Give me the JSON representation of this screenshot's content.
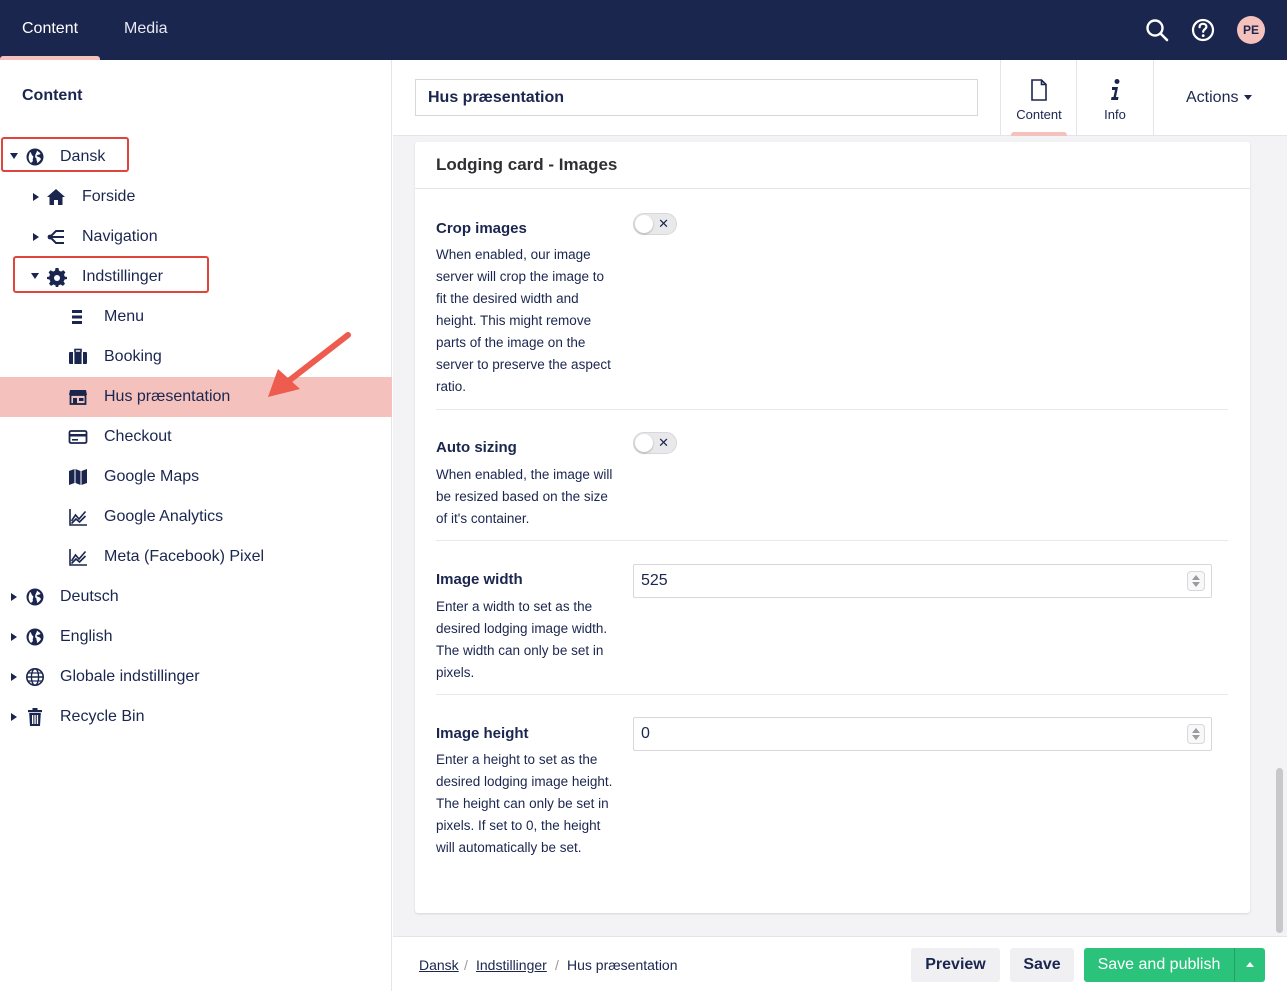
{
  "topnav": {
    "items": [
      {
        "label": "Content",
        "active": true
      },
      {
        "label": "Media",
        "active": false
      }
    ],
    "search_icon": "search-icon",
    "help_icon": "help-icon",
    "avatar_initials": "PE"
  },
  "sidebar": {
    "title": "Content",
    "items": [
      {
        "label": "Dansk",
        "icon": "globe-icon",
        "expanded": true
      },
      {
        "label": "Forside",
        "icon": "home-icon",
        "expanded": false
      },
      {
        "label": "Navigation",
        "icon": "navigation-icon",
        "expanded": false
      },
      {
        "label": "Indstillinger",
        "icon": "settings-icon",
        "expanded": true
      },
      {
        "label": "Menu",
        "icon": "menu-icon"
      },
      {
        "label": "Booking",
        "icon": "briefcase-icon"
      },
      {
        "label": "Hus præsentation",
        "icon": "store-icon",
        "selected": true
      },
      {
        "label": "Checkout",
        "icon": "credit-card-icon"
      },
      {
        "label": "Google Maps",
        "icon": "map-icon"
      },
      {
        "label": "Google Analytics",
        "icon": "chart-icon"
      },
      {
        "label": "Meta (Facebook) Pixel",
        "icon": "chart-icon"
      },
      {
        "label": "Deutsch",
        "icon": "globe-icon",
        "expanded": false
      },
      {
        "label": "English",
        "icon": "globe-icon",
        "expanded": false
      },
      {
        "label": "Globale indstillinger",
        "icon": "world-grid-icon",
        "expanded": false
      },
      {
        "label": "Recycle Bin",
        "icon": "trash-icon",
        "expanded": false
      }
    ]
  },
  "editor": {
    "node_name": "Hus præsentation",
    "apps": [
      {
        "label": "Content",
        "active": true,
        "icon": "document-icon"
      },
      {
        "label": "Info",
        "active": false,
        "icon": "info-icon"
      }
    ],
    "actions_label": "Actions"
  },
  "panel": {
    "title": "Lodging card - Images",
    "properties": [
      {
        "label": "Crop images",
        "description": "When enabled, our image server will crop the image to fit the desired width and height. This might remove parts of the image on the server to preserve the aspect ratio.",
        "type": "toggle",
        "value": false
      },
      {
        "label": "Auto sizing",
        "description": "When enabled, the image will be resized based on the size of it's container.",
        "type": "toggle",
        "value": false
      },
      {
        "label": "Image width",
        "description": "Enter a width to set as the desired lodging image width. The width can only be set in pixels.",
        "type": "number",
        "value": "525"
      },
      {
        "label": "Image height",
        "description": "Enter a height to set as the desired lodging image height. The height can only be set in pixels. If set to 0, the height will automatically be set.",
        "type": "number",
        "value": "0"
      }
    ],
    "toggle_off_glyph": "✕"
  },
  "footer": {
    "breadcrumb": [
      {
        "label": "Dansk",
        "link": true
      },
      {
        "label": "Indstillinger",
        "link": true
      },
      {
        "label": "Hus præsentation",
        "link": false
      }
    ],
    "separator": "/",
    "preview_label": "Preview",
    "save_label": "Save",
    "save_publish_label": "Save and publish"
  },
  "colors": {
    "header_bg": "#1b264f",
    "accent_pink": "#f5c1bc",
    "success_green": "#2bc37c",
    "annotation_red": "#e0453b"
  }
}
